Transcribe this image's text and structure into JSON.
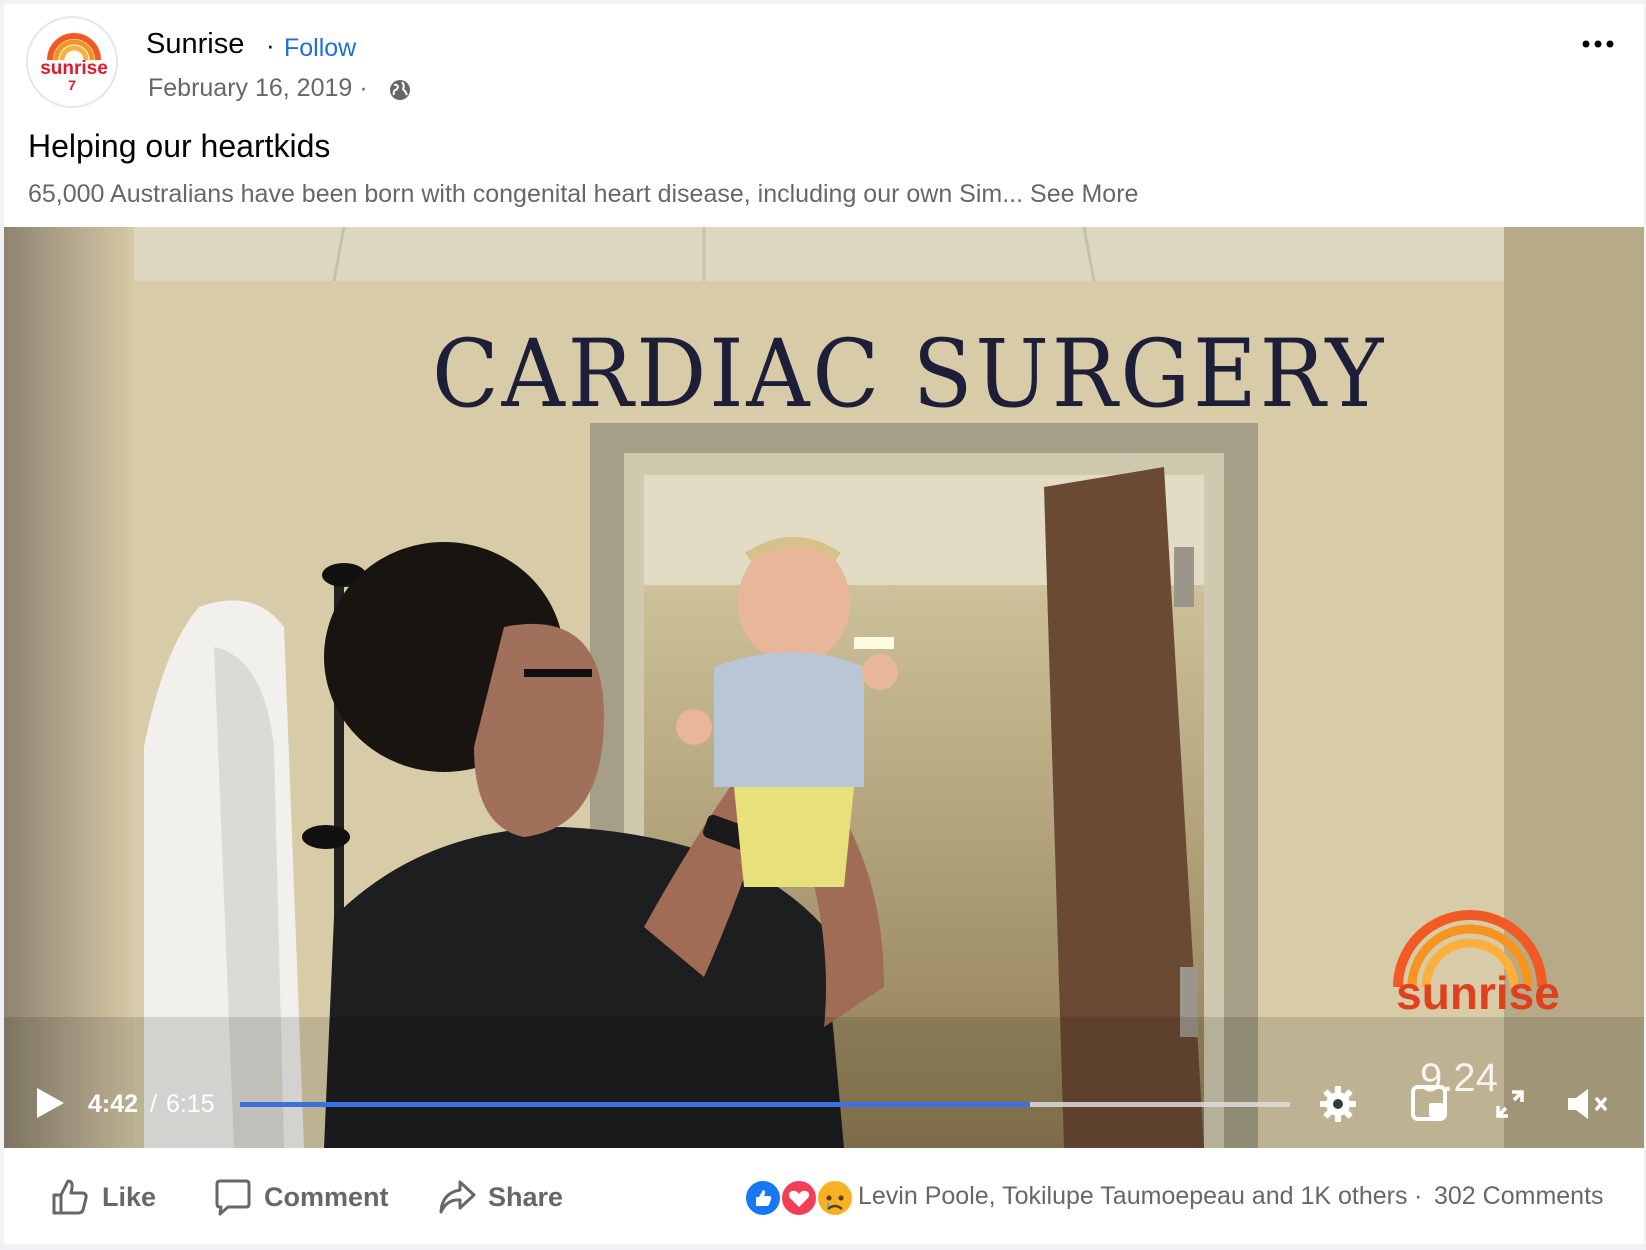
{
  "post": {
    "page_name": "Sunrise",
    "separator": "·",
    "follow_label": "Follow",
    "date": "February 16, 2019 ·",
    "title": "Helping our heartkids",
    "description": "65,000 Australians have been born with congenital heart disease, including our own Sim...",
    "see_more": "See More",
    "avatar_logo_text": "sunrise",
    "avatar_logo_seven": "7"
  },
  "video": {
    "sign_text": "CARDIAC SURGERY",
    "watermark_text": "sunrise",
    "onscreen_time": "9.24",
    "time_current": "4:42",
    "time_separator": "/",
    "time_total": "6:15",
    "progress": 0.752,
    "muted": true,
    "accent": "#3c6fe0"
  },
  "actions": {
    "like_label": "Like",
    "comment_label": "Comment",
    "share_label": "Share",
    "reaction_icons": [
      "like-icon",
      "love-icon",
      "sad-icon"
    ],
    "reaction_names": "Levin Poole, Tokilupe Taumoepeau and 1K others",
    "middot": "·",
    "comments_count": "302 Comments"
  },
  "colors": {
    "link_blue": "#216fdb",
    "secondary_text": "#65676b",
    "primary_text": "#050505",
    "brand_orange": "#f15a24",
    "brand_red": "#e0192b"
  }
}
